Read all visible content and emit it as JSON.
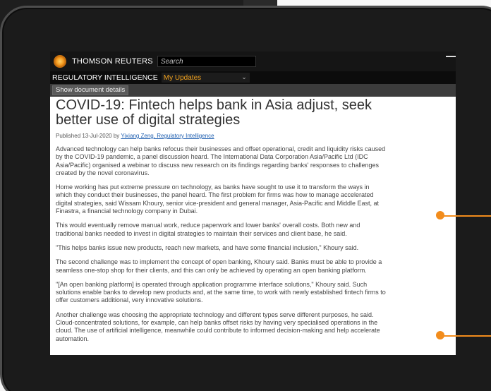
{
  "header": {
    "brand": "THOMSON REUTERS",
    "search_placeholder": "Search"
  },
  "subheader": {
    "section": "REGULATORY INTELLIGENCE",
    "updates_select": "My Updates"
  },
  "toolbar": {
    "details_button": "Show document details"
  },
  "article": {
    "title": "COVID-19: Fintech helps bank in Asia adjust, seek better use of digital strategies",
    "published_prefix": "Published 13-Jul-2020 by ",
    "author": "Yixiang Zeng, Regulatory Intelligence",
    "paragraphs": [
      "Advanced technology can help banks refocus their businesses and offset operational, credit and liquidity risks caused by the COVID-19 pandemic, a panel discussion heard. The International Data Corporation Asia/Pacific Ltd (IDC Asia/Pacific) organised a webinar to discuss new research on its findings regarding banks' responses to challenges created by the novel coronavirus.",
      "Home working has put extreme pressure on technology, as banks have sought to use it to transform the ways in which they conduct their businesses, the panel heard. The first problem for firms was how to manage accelerated digital strategies, said Wissam Khoury, senior vice-president and general manager, Asia-Pacific and Middle East, at Finastra, a financial technology company in Dubai.",
      "This would eventually remove manual work, reduce paperwork and lower banks' overall costs. Both new and traditional banks needed to invest in digital strategies to maintain their services and client base, he said.",
      "\"This helps banks issue new products, reach new markets, and have some financial inclusion,\" Khoury said.",
      "The second challenge was to implement the concept of open banking, Khoury said. Banks must be able to provide a seamless one-stop shop for their clients, and this can only be achieved by operating an open banking platform.",
      "\"[An open banking platform] is operated through application programme interface solutions,\" Khoury said. Such solutions enable banks to develop new products and, at the same time, to work with newly established fintech firms to offer customers additional, very innovative solutions.",
      "Another challenge was choosing the appropriate technology and different types serve different purposes, he said. Cloud-concentrated solutions, for example, can help banks offset risks by having very specialised operations in the cloud. The use of artificial intelligence, meanwhile could contribute to informed decision-making and help accelerate automation."
    ]
  },
  "colors": {
    "accent": "#f28c1c",
    "link": "#1f5fb0",
    "select_text": "#f0a11e"
  }
}
